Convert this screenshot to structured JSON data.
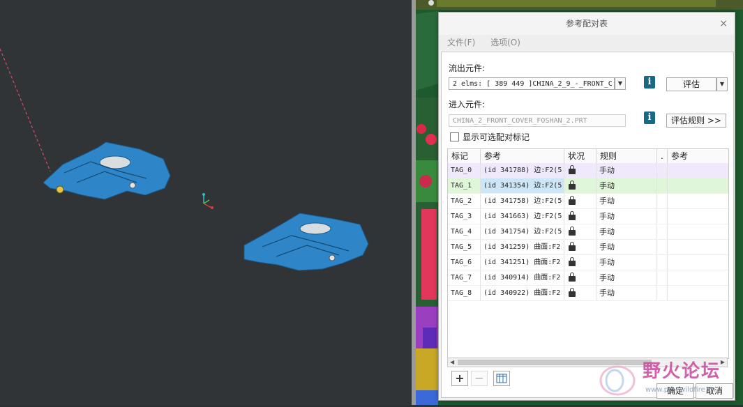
{
  "dialog": {
    "title": "参考配对表",
    "close": "×",
    "menu": {
      "file": "文件(F)",
      "options": "选项(O)"
    },
    "outflow": {
      "label": "流出元件:",
      "value": "2 elms: [ 389 449 ]CHINA_2_9_-_FRONT_C",
      "eval_button": "评估"
    },
    "inflow": {
      "label": "进入元件:",
      "value": "CHINA_2_FRONT_COVER_FOSHAN_2.PRT",
      "rules_button": "评估规则 >>"
    },
    "show_optional_label": "显示可选配对标记",
    "table": {
      "columns": [
        "标记",
        "参考",
        "状况",
        "规则",
        ".",
        "参考"
      ],
      "rows": [
        {
          "tag": "TAG_0",
          "ref": "(id 341788) 边:F2(5",
          "rule": "手动"
        },
        {
          "tag": "TAG_1",
          "ref": "(id 341354) 边:F2(5",
          "rule": "手动"
        },
        {
          "tag": "TAG_2",
          "ref": "(id 341758) 边:F2(5",
          "rule": "手动"
        },
        {
          "tag": "TAG_3",
          "ref": "(id 341663) 边:F2(5",
          "rule": "手动"
        },
        {
          "tag": "TAG_4",
          "ref": "(id 341754) 边:F2(5",
          "rule": "手动"
        },
        {
          "tag": "TAG_5",
          "ref": "(id 341259) 曲面:F2",
          "rule": "手动"
        },
        {
          "tag": "TAG_6",
          "ref": "(id 341251) 曲面:F2",
          "rule": "手动"
        },
        {
          "tag": "TAG_7",
          "ref": "(id 340914) 曲面:F2",
          "rule": "手动"
        },
        {
          "tag": "TAG_8",
          "ref": "(id 340922) 曲面:F2",
          "rule": "手动"
        }
      ]
    },
    "ok_button": "确定",
    "cancel_button": "取消"
  },
  "watermark": {
    "text": "野火论坛",
    "url": "www.proewildfire.cn"
  },
  "colors": {
    "model_blue": "#2e86c8",
    "selection_blue": "#cde6f7",
    "row_tag0": "#efe9fb",
    "row_tag1": "#e0f6d8",
    "info_icon": "#176985"
  }
}
